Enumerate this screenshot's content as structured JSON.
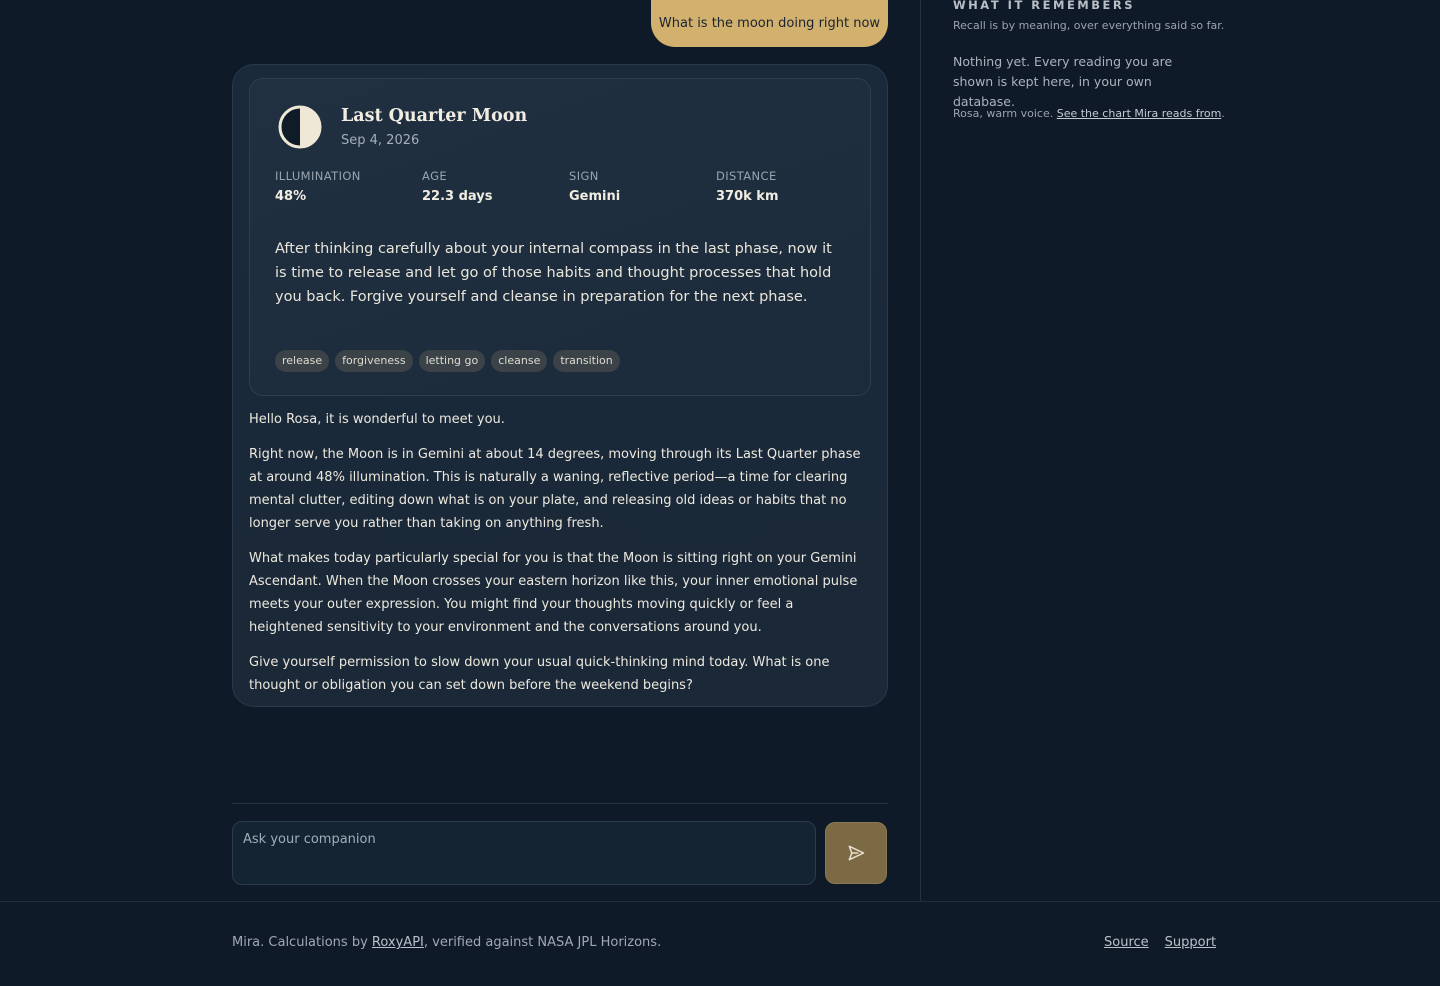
{
  "chat": {
    "user_message": "What is the moon doing right now",
    "moon_card": {
      "icon": "last-quarter-moon-icon",
      "title": "Last Quarter Moon",
      "date": "Sep 4, 2026",
      "stats": [
        {
          "label": "ILLUMINATION",
          "value": "48%"
        },
        {
          "label": "AGE",
          "value": "22.3 days"
        },
        {
          "label": "SIGN",
          "value": "Gemini"
        },
        {
          "label": "DISTANCE",
          "value": "370k km"
        }
      ],
      "reading": "After thinking carefully about your internal compass in the last phase, now it is time to release and let go of those habits and thought processes that hold you back. Forgive yourself and cleanse in preparation for the next phase.",
      "tags": [
        "release",
        "forgiveness",
        "letting go",
        "cleanse",
        "transition"
      ]
    },
    "reply_paragraphs": [
      "Hello Rosa, it is wonderful to meet you.",
      "Right now, the Moon is in Gemini at about 14 degrees, moving through its Last Quarter phase at around 48% illumination. This is naturally a waning, reflective period—a time for clearing mental clutter, editing down what is on your plate, and releasing old ideas or habits that no longer serve you rather than taking on anything fresh.",
      "What makes today particularly special for you is that the Moon is sitting right on your Gemini Ascendant. When the Moon crosses your eastern horizon like this, your inner emotional pulse meets your outer expression. You might find your thoughts moving quickly or feel a heightened sensitivity to your environment and the conversations around you.",
      "Give yourself permission to slow down your usual quick-thinking mind today. What is one thought or obligation you can set down before the weekend begins?"
    ],
    "composer": {
      "placeholder": "Ask your companion",
      "send_icon": "send-icon"
    }
  },
  "sidebar": {
    "heading": "WHAT IT REMEMBERS",
    "subheading": "Recall is by meaning, over everything said so far.",
    "empty_state": "Nothing yet. Every reading you are shown is kept here, in your own database.",
    "voice_prefix": "Rosa, warm voice. ",
    "voice_link": "See the chart Mira reads from",
    "voice_suffix": "."
  },
  "footer": {
    "note_prefix": "Mira. Calculations by ",
    "note_link": "RoxyAPI",
    "note_suffix": ", verified against NASA JPL Horizons.",
    "links": [
      "Source",
      "Support"
    ]
  },
  "colors": {
    "background": "#0e1a28",
    "accent_gold": "#d2b06e",
    "send_button": "#7c6a45",
    "card": "#1b2a3a",
    "tag": "#3b4348"
  }
}
